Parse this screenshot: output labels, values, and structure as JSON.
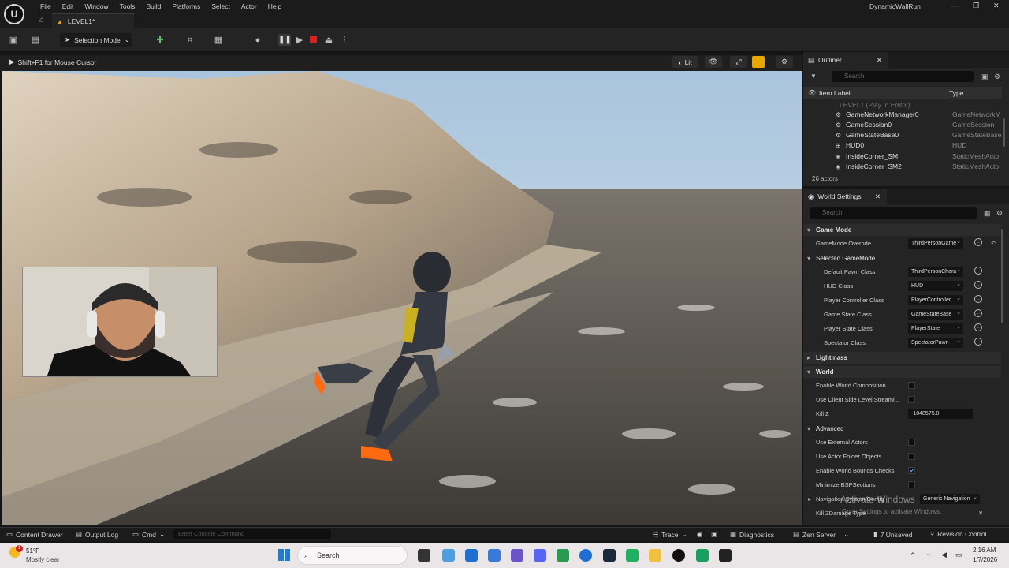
{
  "titlebar": {
    "menu": [
      "File",
      "Edit",
      "Window",
      "Tools",
      "Build",
      "Platforms",
      "Select",
      "Actor",
      "Help"
    ],
    "project_name": "DynamicWallRun"
  },
  "tab": {
    "level": "LEVEL1*"
  },
  "toolbar": {
    "selection_mode": "Selection Mode"
  },
  "viewport": {
    "hint": "Shift+F1 for Mouse Cursor",
    "lit": "Lit"
  },
  "outliner": {
    "title": "Outliner",
    "search_placeholder": "Search",
    "col_label": "Item Label",
    "col_type": "Type",
    "root": "LEVEL1 (Play In Editor)",
    "rows": [
      {
        "label": "GameNetworkManager0",
        "type": "GameNetworkM",
        "icon": "gear-icon"
      },
      {
        "label": "GameSession0",
        "type": "GameSession",
        "icon": "gear-icon"
      },
      {
        "label": "GameStateBase0",
        "type": "GameStateBase",
        "icon": "gear-icon"
      },
      {
        "label": "HUD0",
        "type": "HUD",
        "icon": "hud-icon"
      },
      {
        "label": "InsideCorner_SM",
        "type": "StaticMeshActo",
        "icon": "mesh-icon"
      },
      {
        "label": "InsideCorner_SM2",
        "type": "StaticMeshActo",
        "icon": "mesh-icon"
      }
    ],
    "count": "26 actors"
  },
  "world_settings": {
    "title": "World Settings",
    "search_placeholder": "Search",
    "sections": {
      "game_mode": "Game Mode",
      "selected_game_mode": "Selected GameMode",
      "lightmass": "Lightmass",
      "world": "World",
      "advanced": "Advanced"
    },
    "game_mode_override": {
      "label": "GameMode Override",
      "value": "ThirdPersonGame"
    },
    "selected": [
      {
        "label": "Default Pawn Class",
        "value": "ThirdPersonChara"
      },
      {
        "label": "HUD Class",
        "value": "HUD"
      },
      {
        "label": "Player Controller Class",
        "value": "PlayerController"
      },
      {
        "label": "Game State Class",
        "value": "GameStateBase"
      },
      {
        "label": "Player State Class",
        "value": "PlayerState"
      },
      {
        "label": "Spectator Class",
        "value": "SpectatorPawn"
      }
    ],
    "world_props": [
      {
        "label": "Enable World Composition",
        "checked": false
      },
      {
        "label": "Use Client Side Level Streami...",
        "checked": false
      }
    ],
    "kill_z": {
      "label": "Kill Z",
      "value": "-1048575.0"
    },
    "advanced_props": [
      {
        "label": "Use External Actors",
        "checked": false
      },
      {
        "label": "Use Actor Folder Objects",
        "checked": false
      },
      {
        "label": "Enable World Bounds Checks",
        "checked": true
      },
      {
        "label": "Minimize BSPSections",
        "checked": false
      }
    ],
    "nav_system": {
      "label": "Navigation System Config",
      "value": "Generic Navigation"
    },
    "kill_z_damage": "Kill ZDamage Type"
  },
  "bottombar": {
    "content_drawer": "Content Drawer",
    "output_log": "Output Log",
    "cmd": "Cmd",
    "console_placeholder": "Enter Console Command",
    "trace": "Trace",
    "diagnostics": "Diagnostics",
    "zen_server": "Zen Server",
    "unsaved": "7 Unsaved",
    "revision_control": "Revision Control"
  },
  "taskbar": {
    "temp": "51°F",
    "weather": "Mostly clear",
    "badge": "1",
    "search": "Search",
    "time": "2:16 AM",
    "date": "1/7/2026"
  },
  "watermark": {
    "line1": "Activate Windows",
    "line2": "Go to Settings to activate Windows."
  }
}
